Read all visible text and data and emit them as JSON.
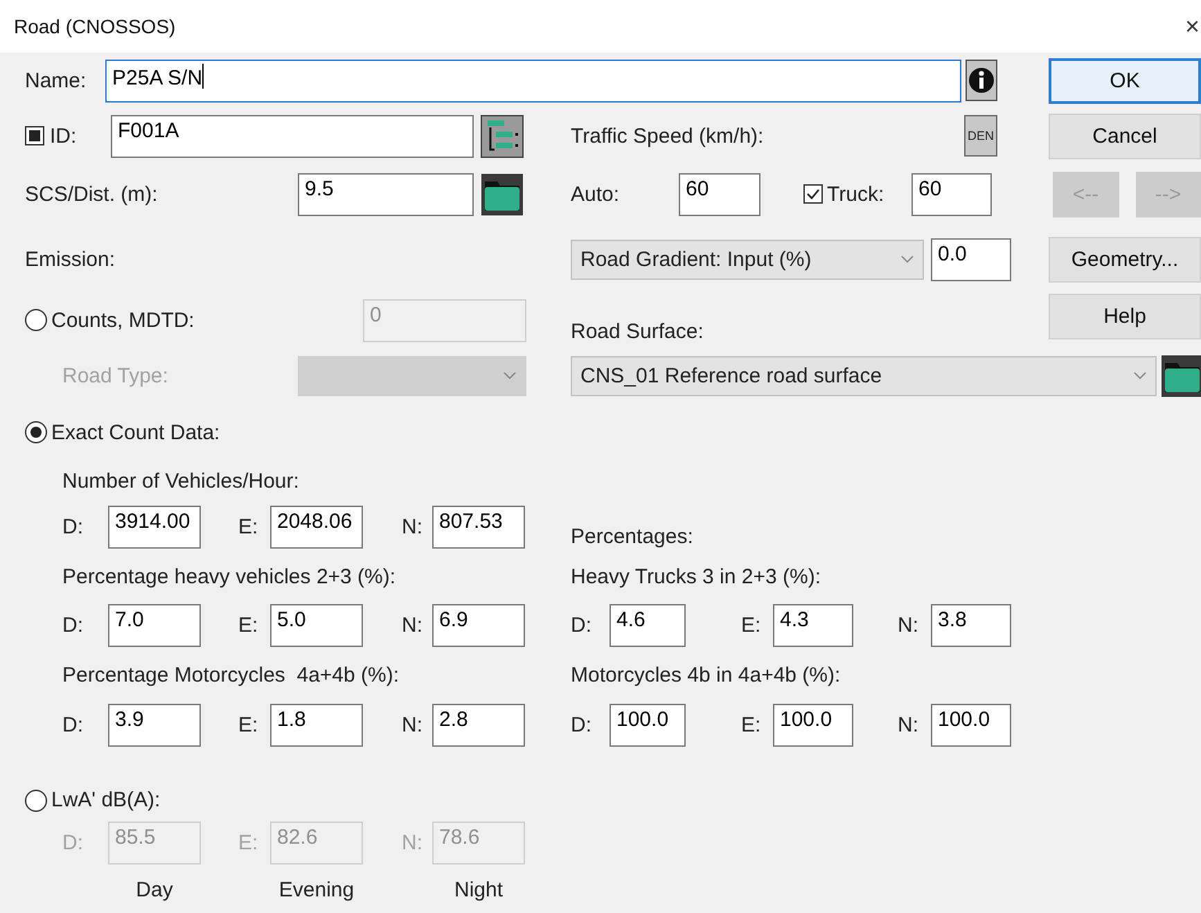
{
  "window": {
    "title": "Road (CNOSSOS)",
    "close": "×"
  },
  "name": {
    "label": "Name:",
    "value": "P25A S/N",
    "focused": true
  },
  "id": {
    "checked": true,
    "label": "ID:",
    "value": "F001A"
  },
  "scs_distance": {
    "label": "SCS/Dist. (m):",
    "value": "9.5"
  },
  "traffic_speed": {
    "label": "Traffic Speed (km/h):",
    "den_button": "DEN",
    "auto_label": "Auto:",
    "auto_value": "60",
    "truck_checked": true,
    "truck_label": "Truck:",
    "truck_value": "60"
  },
  "gradient": {
    "mode": "Road Gradient: Input (%)",
    "value": "0.0"
  },
  "road_surface": {
    "label": "Road Surface:",
    "value": "CNS_01 Reference road surface"
  },
  "emission_label": "Emission:",
  "counts": {
    "label": "Counts, MDTD:",
    "selected": false,
    "disabled": true,
    "value": "0",
    "road_type_label": "Road Type:"
  },
  "exact": {
    "label": "Exact Count Data:",
    "selected": true,
    "groups": [
      {
        "heading": "Number of Vehicles/Hour:",
        "fields": [
          {
            "label": "D:",
            "value": "3914.00"
          },
          {
            "label": "E:",
            "value": "2048.06"
          },
          {
            "label": "N:",
            "value": "807.53"
          }
        ]
      },
      {
        "heading": "Percentage heavy vehicles 2+3 (%):",
        "fields": [
          {
            "label": "D:",
            "value": "7.0"
          },
          {
            "label": "E:",
            "value": "5.0"
          },
          {
            "label": "N:",
            "value": "6.9"
          }
        ]
      },
      {
        "heading": "Percentage Motorcycles  4a+4b (%):",
        "fields": [
          {
            "label": "D:",
            "value": "3.9"
          },
          {
            "label": "E:",
            "value": "1.8"
          },
          {
            "label": "N:",
            "value": "2.8"
          }
        ]
      }
    ]
  },
  "percentages": {
    "label": "Percentages:",
    "groups": [
      {
        "heading": "Heavy Trucks 3 in 2+3 (%):",
        "fields": [
          {
            "label": "D:",
            "value": "4.6"
          },
          {
            "label": "E:",
            "value": "4.3"
          },
          {
            "label": "N:",
            "value": "3.8"
          }
        ]
      },
      {
        "heading": "Motorcycles 4b in 4a+4b (%):",
        "fields": [
          {
            "label": "D:",
            "value": "100.0"
          },
          {
            "label": "E:",
            "value": "100.0"
          },
          {
            "label": "N:",
            "value": "100.0"
          }
        ]
      }
    ]
  },
  "lwa": {
    "label": "LwA' dB(A):",
    "selected": false,
    "disabled": true,
    "fields": [
      {
        "label": "D:",
        "value": "85.5"
      },
      {
        "label": "E:",
        "value": "82.6"
      },
      {
        "label": "N:",
        "value": "78.6"
      }
    ],
    "periods": [
      "Day",
      "Evening",
      "Night"
    ]
  },
  "buttons": [
    {
      "label": "OK",
      "default": true,
      "disabled": false
    },
    {
      "label": "Cancel",
      "default": false,
      "disabled": false
    },
    {
      "label": "<--",
      "default": false,
      "disabled": true
    },
    {
      "label": "-->",
      "default": false,
      "disabled": true
    },
    {
      "label": "Geometry...",
      "default": false,
      "disabled": false
    },
    {
      "label": "Help",
      "default": false,
      "disabled": false
    }
  ]
}
